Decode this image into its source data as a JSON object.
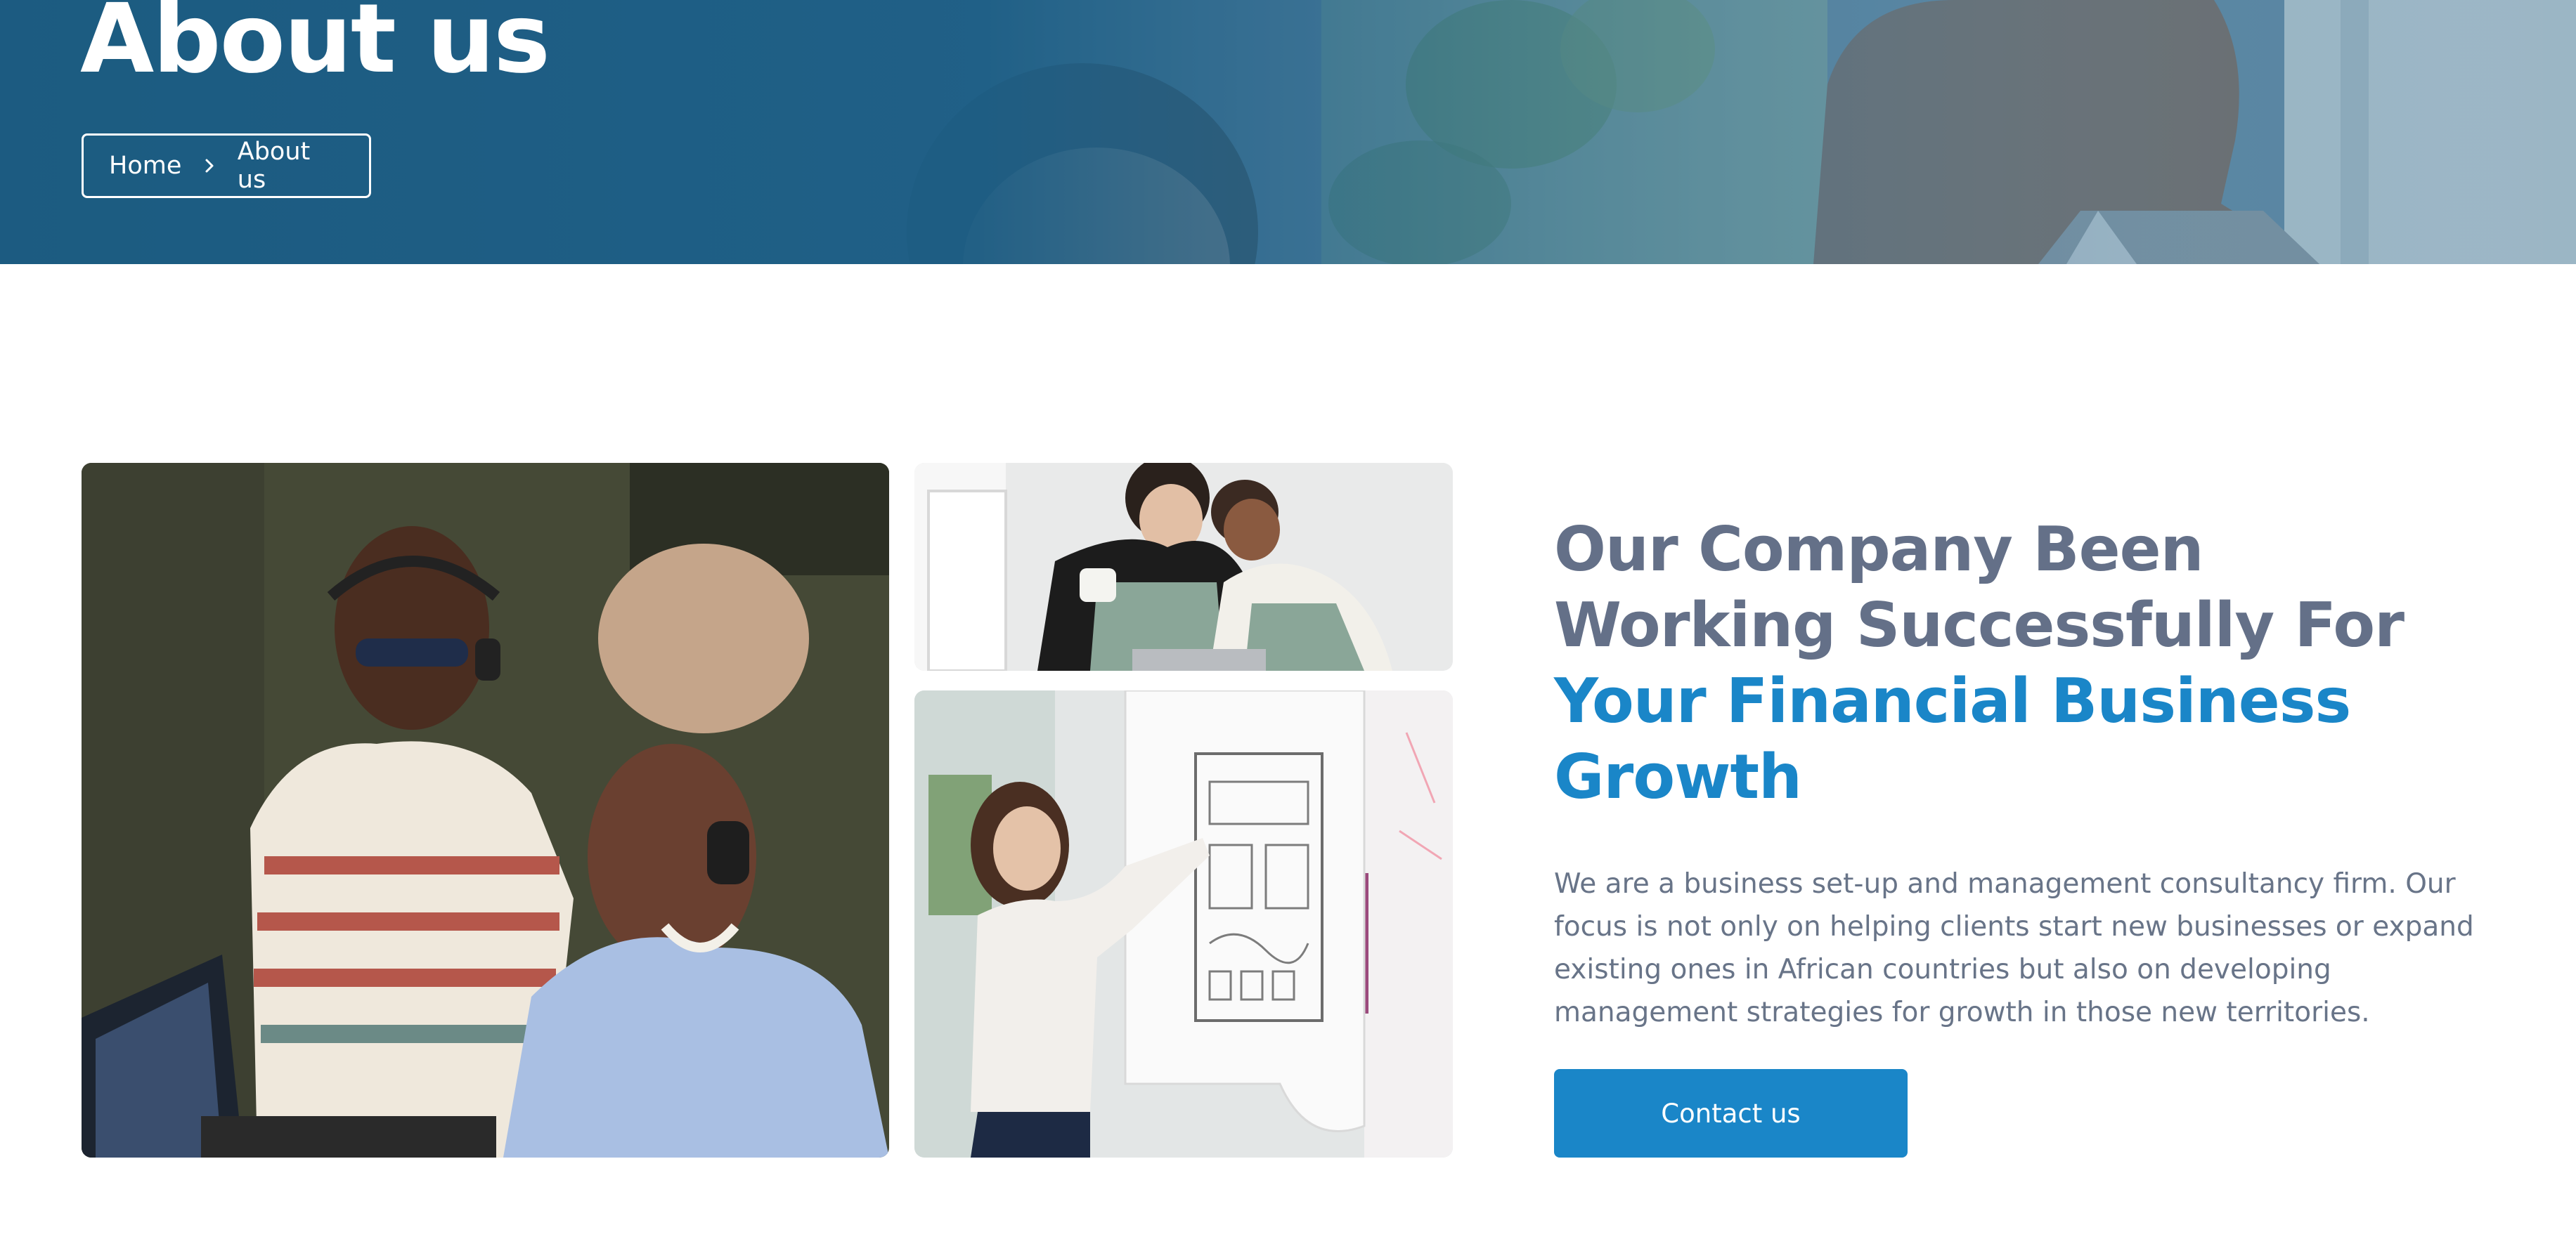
{
  "hero": {
    "title": "About us",
    "breadcrumb": {
      "home": "Home",
      "current": "About us"
    }
  },
  "about": {
    "heading_plain": "Our Company Been Working Successfully For ",
    "heading_accent": "Your Financial Business Growth",
    "description": "We are a business set-up and management consultancy firm. Our focus is not only on helping clients start new businesses or expand existing ones in African countries but also on developing management strategies for growth in those new territories.",
    "cta_label": "Contact us"
  },
  "icons": {
    "breadcrumb_separator": "chevron-right-icon"
  },
  "colors": {
    "accent": "#1a86c8",
    "heading_gray": "#647088",
    "body_text": "#687488",
    "hero_overlay": "#1e5e84",
    "white": "#ffffff"
  }
}
